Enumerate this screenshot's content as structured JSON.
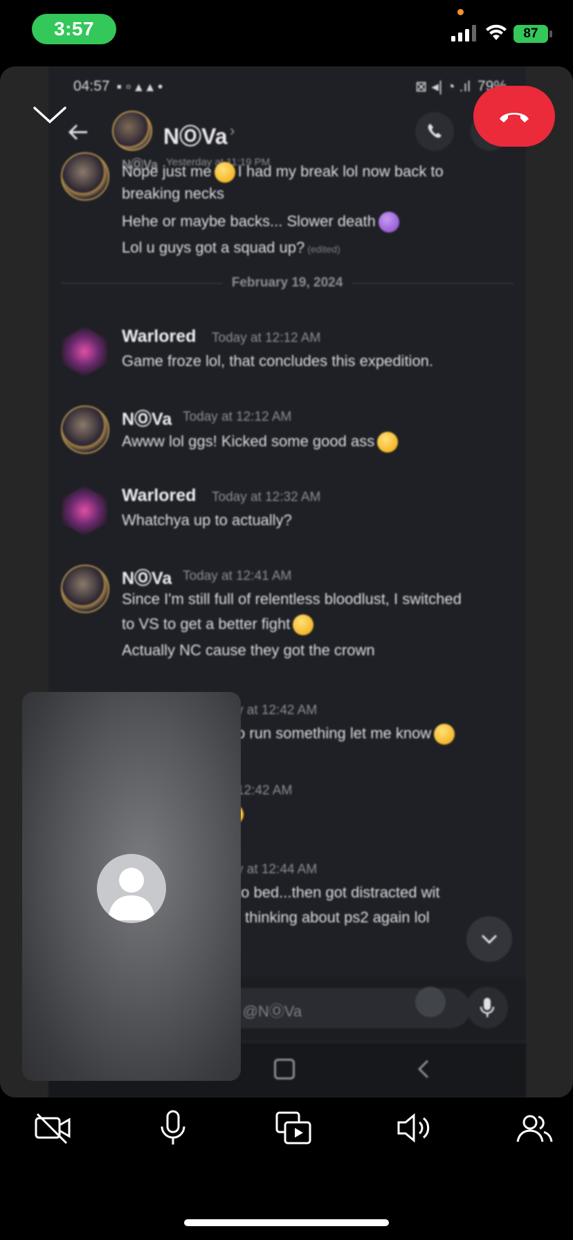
{
  "ios_status": {
    "time": "3:57",
    "battery": "87"
  },
  "android_status": {
    "time": "04:57",
    "battery": "79%"
  },
  "chat": {
    "contact_name": "NⓄVa",
    "messages": [
      {
        "author": "NⓄVa",
        "time": "Yesterday at 11:19 PM",
        "lines": [
          {
            "text": "Nope just me",
            "after": "I had my break lol now back to"
          },
          {
            "text": "breaking necks"
          },
          {
            "text": "Hehe or maybe backs... Slower death"
          },
          {
            "text": "Lol u guys got a squad up?",
            "edited": "(edited)"
          }
        ]
      },
      {
        "author": "Warlored",
        "time": "Today at 12:12 AM",
        "lines": [
          {
            "text": "Game froze lol, that concludes this expedition."
          }
        ]
      },
      {
        "author": "NⓄVa",
        "time": "Today at 12:12 AM",
        "lines": [
          {
            "text": "Awww lol ggs! Kicked some good ass"
          }
        ]
      },
      {
        "author": "Warlored",
        "time": "Today at 12:32 AM",
        "lines": [
          {
            "text": "Whatchya up to actually?"
          }
        ]
      },
      {
        "author": "NⓄVa",
        "time": "Today at 12:41 AM",
        "lines": [
          {
            "text": "Since I'm still full of relentless bloodlust, I switched"
          },
          {
            "text": "to VS to get a better fight"
          },
          {
            "text": "Actually NC cause they got the crown"
          }
        ]
      },
      {
        "time_partial": "y at 12:42 AM",
        "lines": [
          {
            "text": "o run something let me know"
          }
        ]
      },
      {
        "time_partial": "12:42 AM"
      },
      {
        "time_partial": "y at 12:44 AM",
        "lines": [
          {
            "text": "to bed...then got distracted wit"
          },
          {
            "text": "thinking about ps2 again lol"
          }
        ]
      }
    ],
    "date_divider": "February 19, 2024",
    "composer_placeholder": "ge @NⓄVa"
  },
  "call_controls": [
    "camera-off",
    "microphone",
    "screen-share",
    "speaker",
    "participants"
  ],
  "colors": {
    "end_call": "#eb2a3a",
    "ios_green": "#34c759",
    "discord_bg": "#1f2025"
  }
}
